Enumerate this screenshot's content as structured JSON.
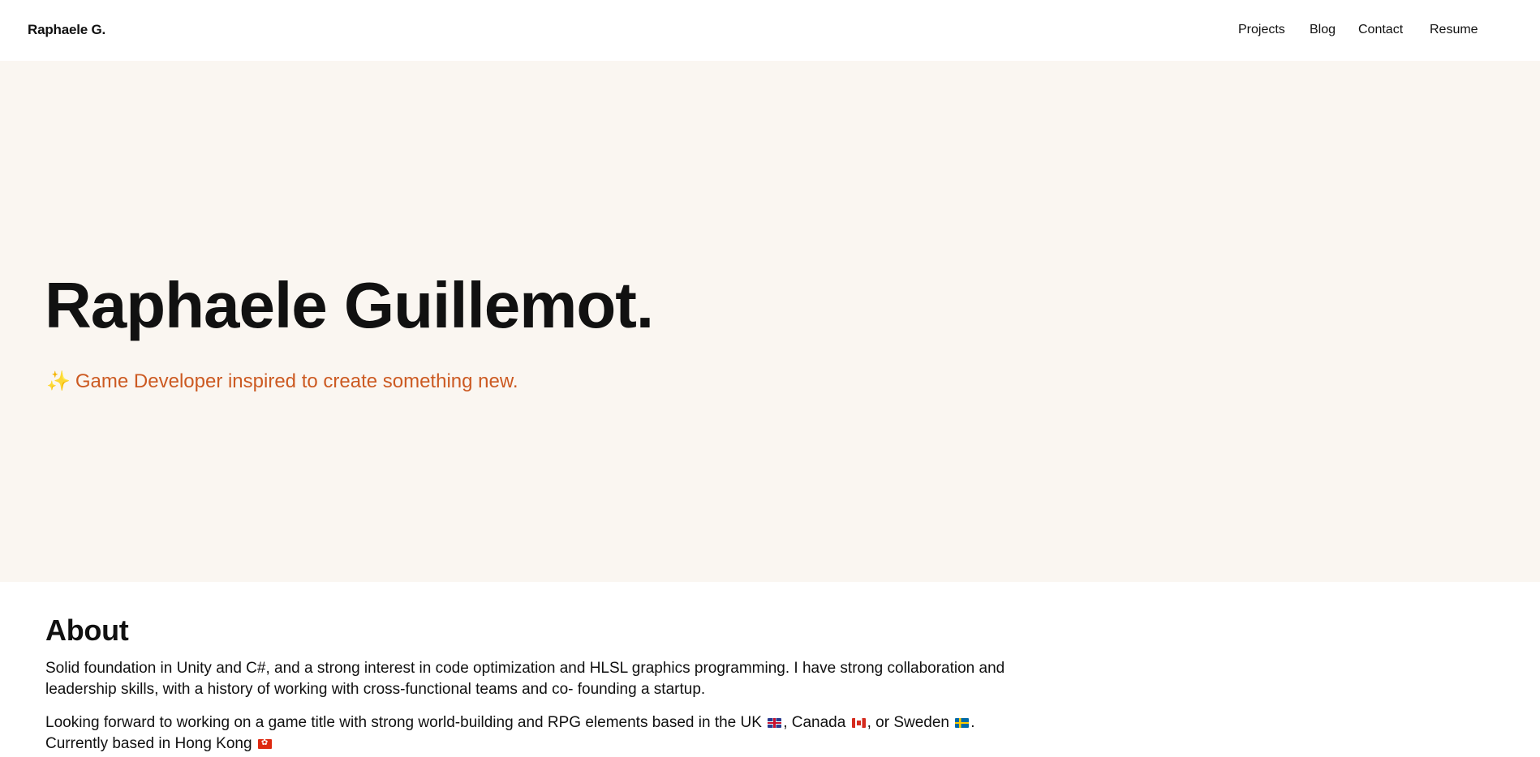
{
  "header": {
    "brand": "Raphaele G.",
    "nav": [
      {
        "label": "Projects"
      },
      {
        "label": "Blog"
      },
      {
        "label": "Contact"
      },
      {
        "label": "Resume"
      }
    ]
  },
  "hero": {
    "title": "Raphaele Guillemot.",
    "sparkle": "✨",
    "subtitle": "Game Developer inspired to create something new."
  },
  "about": {
    "heading": "About",
    "paragraph1": "Solid foundation in Unity and C#, and a strong interest in code optimization and HLSL graphics programming. I have strong collaboration and leadership skills, with a history of working with cross-functional teams and co- founding a startup.",
    "paragraph2": {
      "part1": "Looking forward to working on a game title with strong world-building and RPG elements based in the UK",
      "part2": ", Canada",
      "part3": ", or Sweden",
      "part4": ".",
      "part5": "Currently based in Hong Kong"
    },
    "flags": [
      "uk-flag-icon",
      "canada-flag-icon",
      "sweden-flag-icon",
      "hong-kong-flag-icon"
    ]
  },
  "colors": {
    "hero_background": "#faf6f1",
    "accent": "#cc5a22",
    "text": "#111111"
  }
}
